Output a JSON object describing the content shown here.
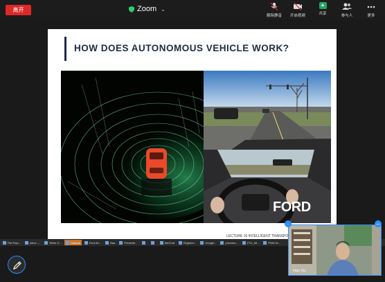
{
  "topbar": {
    "leave_label": "离开",
    "title": "Zoom",
    "buttons": [
      {
        "label": "解除静音",
        "icon": "mic-muted-icon"
      },
      {
        "label": "开启视频",
        "icon": "camera-off-icon"
      },
      {
        "label": "共享",
        "icon": "share-screen-icon"
      },
      {
        "label": "参与人",
        "icon": "participants-icon"
      },
      {
        "label": "更多",
        "icon": "more-icon"
      }
    ]
  },
  "slide": {
    "title": "HOW DOES AUTONOMOUS VEHICLE WORK?",
    "footer": "LECTURE 16 INTELLIGENT TRANSPORTATION S",
    "brand": "FORD"
  },
  "taskbar": {
    "items": [
      "File Expl...",
      "Inbox -...",
      "Week G...",
      "Outlook",
      "Ford Ab...",
      "Baa",
      "Presente...",
      "",
      "",
      "WeChat",
      "Registra...",
      "Google...",
      "pmovies...",
      "ZTU_Mi...",
      "PNW Dr..."
    ]
  },
  "self_video": {
    "name": "Hao Xu"
  },
  "colors": {
    "leave_red": "#e02828",
    "share_green": "#25a55f",
    "accent_blue": "#2d8cff"
  }
}
